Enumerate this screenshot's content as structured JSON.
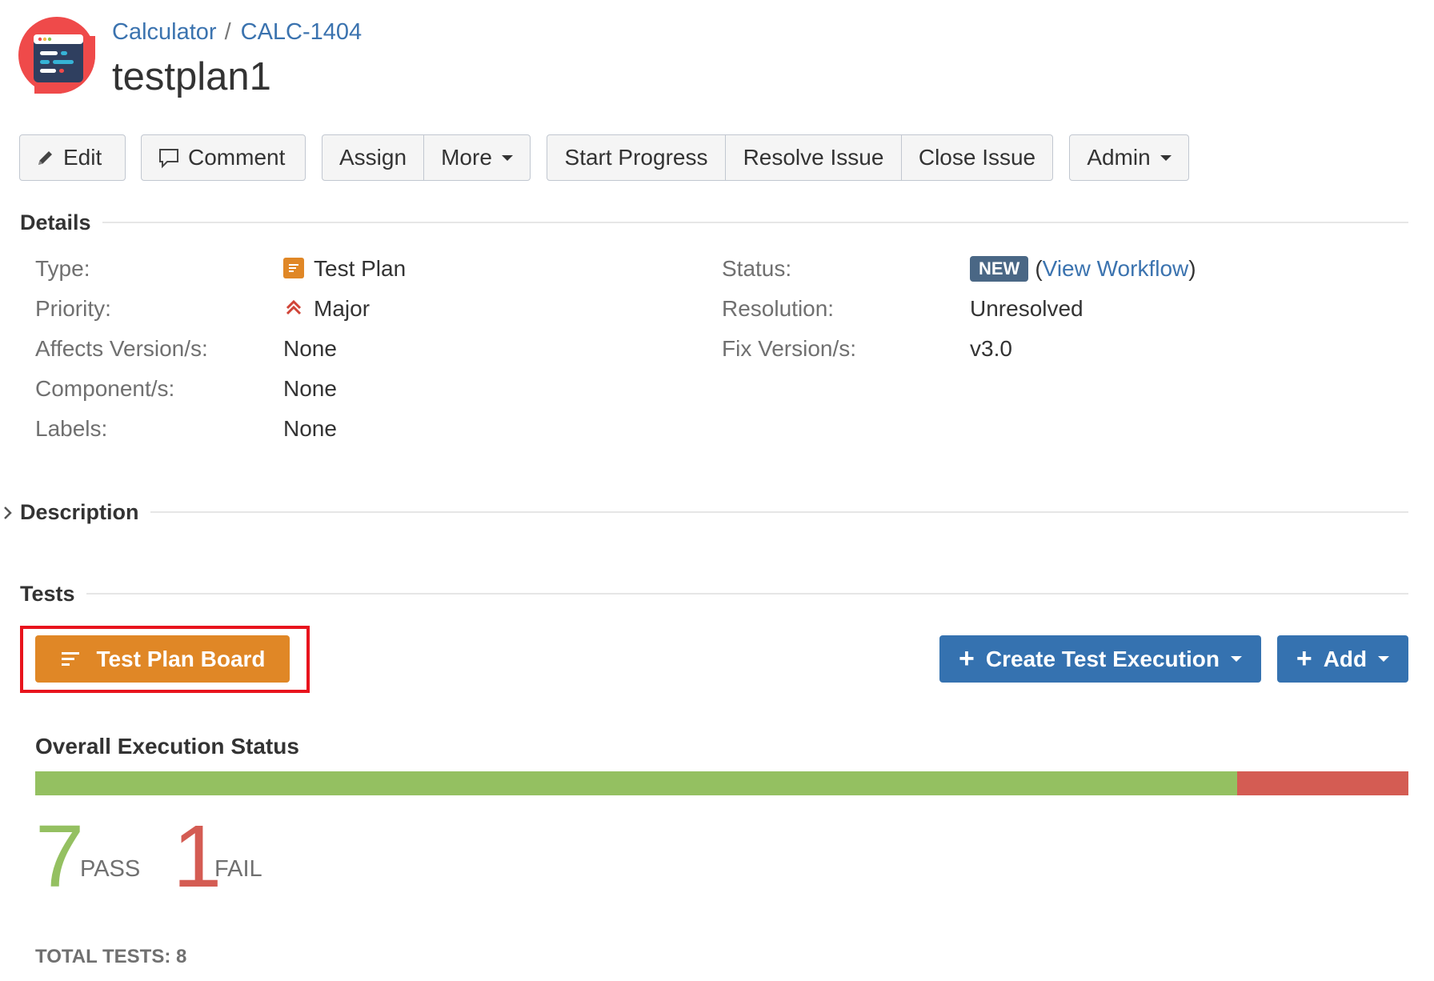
{
  "breadcrumb": {
    "project": "Calculator",
    "separator": "/",
    "issue_key": "CALC-1404"
  },
  "issue": {
    "title": "testplan1"
  },
  "toolbar": {
    "edit": "Edit",
    "comment": "Comment",
    "assign": "Assign",
    "more": "More",
    "start_progress": "Start Progress",
    "resolve_issue": "Resolve Issue",
    "close_issue": "Close Issue",
    "admin": "Admin"
  },
  "details": {
    "heading": "Details",
    "type": {
      "label": "Type:",
      "value": "Test Plan",
      "icon": "test-plan-icon"
    },
    "priority": {
      "label": "Priority:",
      "value": "Major",
      "icon": "priority-major-icon",
      "color": "#d04437"
    },
    "affects_versions": {
      "label": "Affects Version/s:",
      "value": "None"
    },
    "components": {
      "label": "Component/s:",
      "value": "None"
    },
    "labels": {
      "label": "Labels:",
      "value": "None"
    },
    "status": {
      "label": "Status:",
      "value": "NEW",
      "open_paren": "(",
      "link": "View Workflow",
      "close_paren": ")"
    },
    "resolution": {
      "label": "Resolution:",
      "value": "Unresolved"
    },
    "fix_versions": {
      "label": "Fix Version/s:",
      "value": "v3.0"
    }
  },
  "description": {
    "heading": "Description"
  },
  "tests": {
    "heading": "Tests",
    "test_plan_board": "Test Plan Board",
    "create_test_execution": "Create Test Execution",
    "add": "Add"
  },
  "execution": {
    "title": "Overall Execution Status",
    "pass": {
      "count": "7",
      "label": "PASS",
      "color": "#94c061",
      "fraction": 0.875
    },
    "fail": {
      "count": "1",
      "label": "FAIL",
      "color": "#d45c53",
      "fraction": 0.125
    },
    "total": "TOTAL TESTS: 8"
  },
  "colors": {
    "accent": "#3572b0",
    "link": "#3b73af",
    "orange": "#e08726",
    "highlight": "#e8141d"
  }
}
